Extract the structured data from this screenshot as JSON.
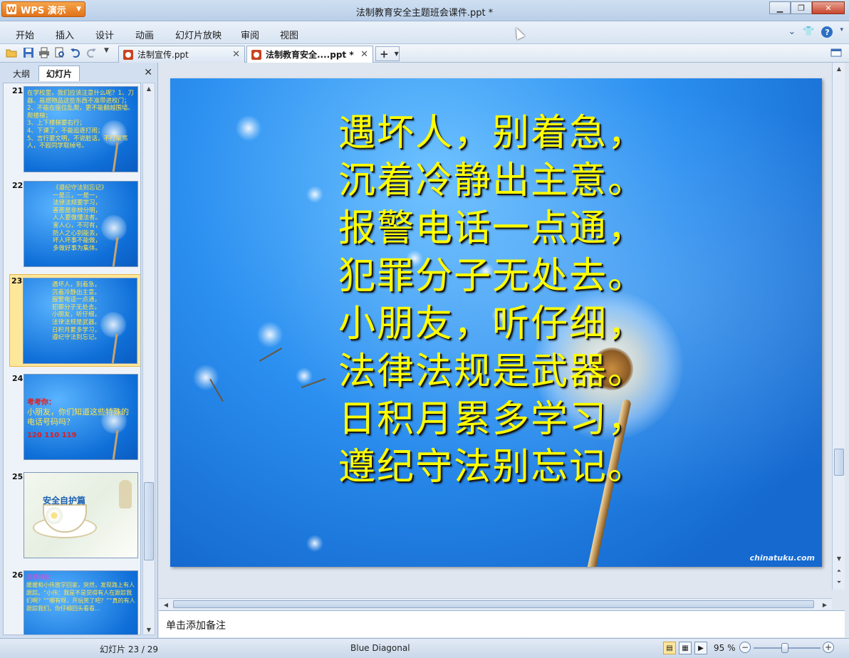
{
  "app": {
    "name": "WPS 演示",
    "window_title": "法制教育安全主题班会课件.ppt *"
  },
  "menu": [
    "开始",
    "插入",
    "设计",
    "动画",
    "幻灯片放映",
    "审阅",
    "视图"
  ],
  "doc_tabs": [
    {
      "label": "法制宣传.ppt",
      "active": false
    },
    {
      "label": "法制教育安全....ppt *",
      "active": true
    }
  ],
  "panel": {
    "tabs": [
      "大纲",
      "幻灯片"
    ],
    "active_tab": "幻灯片"
  },
  "thumbnails": [
    {
      "number": "21",
      "text": "    在学校里，我们应该注意什么呢？1、刀器、易燃物品这些东西不准带进校门；\n2、不能在座位乱爬，更不能翻越围墙、爬楼梯；\n3、上下楼梯要右行；\n4、下课了，不能追逐打闹；\n5、言行要文明，不说脏话，不打架骂人，不殴同学取绰号。"
    },
    {
      "number": "22",
      "text": "《遵纪守法别忘记》\n一是三，一是一，\n法律法规要学习，\n善恶是非辨分明，\n人人要做懂法者。\n害人心，不可有，\n防人之心别能丢，\n坏人坏事不能做，\n多做好事为集体。"
    },
    {
      "number": "23",
      "text": "遇坏人，别着急，\n沉着冷静出主意。\n报警电话一点通，\n犯罪分子无处去。\n小朋友，听仔细，\n法律法规是武器。\n日积月累多学习，\n遵纪守法别忘记。"
    },
    {
      "number": "24",
      "label": "考考你：",
      "text": "小朋友，你们知道这些特殊的电话号码吗？",
      "numbers": "120  110  119"
    },
    {
      "number": "25",
      "title": "安全自护篇"
    },
    {
      "number": "26",
      "label": "反思讨论：",
      "text": "    媛媛和小伟放学回家，突然，发现路上有人跟踪。“小伟：我是不是觉得有人在跟踪我们啊？”“哪有呀，开玩笑了吧？”“真的有人跟踪我们，你仔细回头看看..."
    }
  ],
  "slide": {
    "lines": [
      "遇坏人，别着急，",
      "沉着冷静出主意。",
      "报警电话一点通，",
      "犯罪分子无处去。",
      "小朋友，听仔细，",
      "法律法规是武器。",
      "日积月累多学习，",
      "遵纪守法别忘记。"
    ],
    "watermark": "chinatuku.com",
    "text_color": "#ffff00"
  },
  "notes_placeholder": "单击添加备注",
  "status": {
    "slide_position": "幻灯片 23 / 29",
    "theme": "Blue Diagonal",
    "zoom": "95 %"
  }
}
